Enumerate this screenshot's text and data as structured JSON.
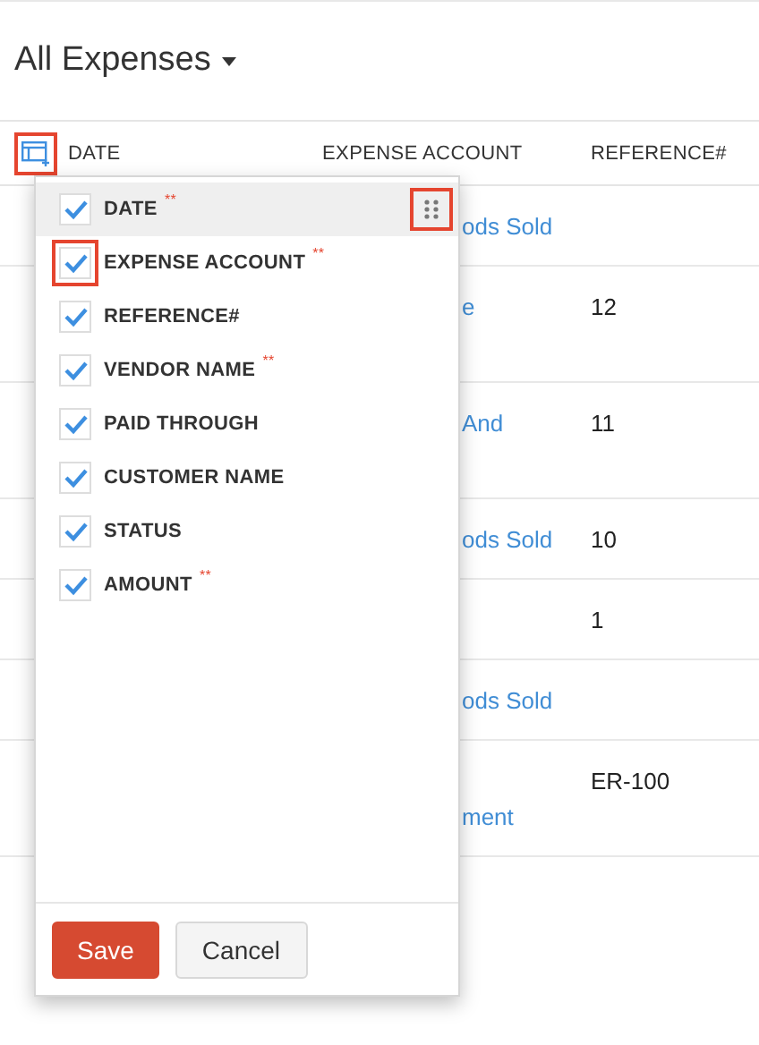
{
  "title": "All Expenses",
  "column_picker": {
    "highlighted": true
  },
  "columns": [
    "DATE",
    "EXPENSE ACCOUNT",
    "REFERENCE#"
  ],
  "rows": [
    {
      "tall": false,
      "expense_account": "ods Sold"
    },
    {
      "tall": true,
      "expense_account": "e",
      "reference": "12"
    },
    {
      "tall": true,
      "expense_account": "And",
      "reference": "11"
    },
    {
      "tall": false,
      "expense_account": "ods Sold",
      "reference": "10"
    },
    {
      "tall": false,
      "reference": "1"
    },
    {
      "tall": false,
      "expense_account": "ods Sold"
    },
    {
      "tall": true,
      "expense_account_second_line": "ment",
      "reference": "ER-100"
    }
  ],
  "menu": {
    "items": [
      {
        "label": "DATE",
        "mark": "**",
        "checked": true,
        "hovered": true,
        "handle_highlighted": true,
        "checkbox_highlighted": false
      },
      {
        "label": "EXPENSE ACCOUNT",
        "mark": "**",
        "checked": true,
        "hovered": false,
        "handle_highlighted": false,
        "checkbox_highlighted": true
      },
      {
        "label": "REFERENCE#",
        "checked": true,
        "hovered": false,
        "handle_highlighted": false,
        "checkbox_highlighted": false
      },
      {
        "label": "VENDOR NAME",
        "mark": "**",
        "checked": true,
        "hovered": false,
        "handle_highlighted": false,
        "checkbox_highlighted": false
      },
      {
        "label": "PAID THROUGH",
        "checked": true,
        "hovered": false,
        "handle_highlighted": false,
        "checkbox_highlighted": false
      },
      {
        "label": "CUSTOMER NAME",
        "checked": true,
        "hovered": false,
        "handle_highlighted": false,
        "checkbox_highlighted": false
      },
      {
        "label": "STATUS",
        "checked": true,
        "hovered": false,
        "handle_highlighted": false,
        "checkbox_highlighted": false
      },
      {
        "label": "AMOUNT",
        "mark": "**",
        "checked": true,
        "hovered": false,
        "handle_highlighted": false,
        "checkbox_highlighted": false
      }
    ],
    "buttons": [
      {
        "label": "Save",
        "kind": "primary"
      },
      {
        "label": "Cancel",
        "kind": "secondary"
      }
    ]
  }
}
